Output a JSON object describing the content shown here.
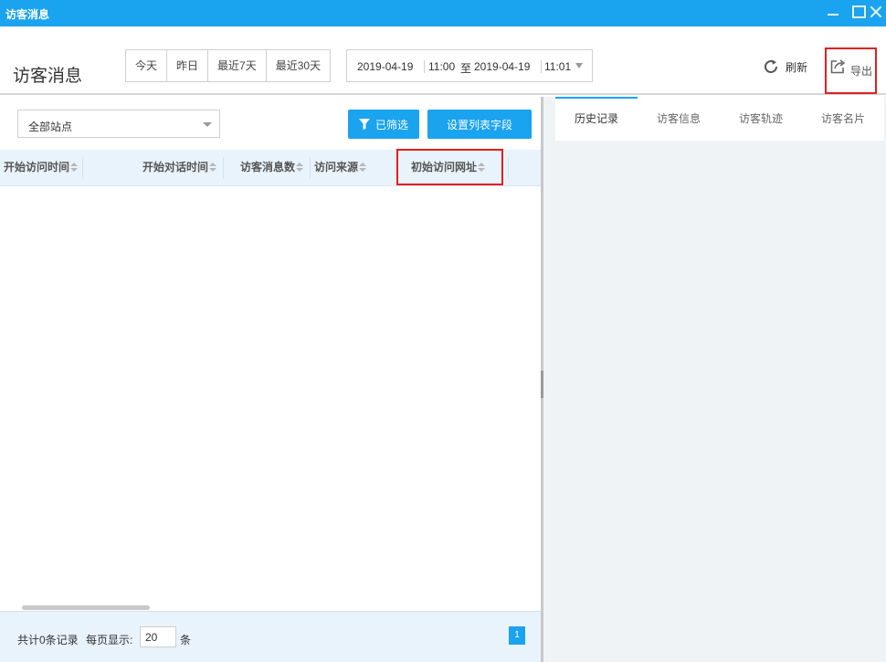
{
  "window": {
    "title": "访客消息"
  },
  "header": {
    "page_title": "访客消息",
    "date_buttons": [
      "今天",
      "昨日",
      "最近7天",
      "最近30天"
    ],
    "range": {
      "start_date": "2019-04-19",
      "start_time": "11:00",
      "to": "至",
      "end_date": "2019-04-19",
      "end_time": "11:01"
    },
    "refresh_label": "刷新",
    "export_label": "导出"
  },
  "toolbar": {
    "site_select_value": "全部站点",
    "filter_label": "已筛选",
    "set_fields_label": "设置列表字段"
  },
  "table": {
    "columns": [
      "开始访问时间",
      "开始对话时间",
      "访客消息数",
      "访问来源",
      "初始访问网址"
    ],
    "rows": []
  },
  "footer": {
    "total_label": "共计0条记录",
    "per_page_label": "每页显示:",
    "page_size": "20",
    "unit": "条",
    "current_page": "1"
  },
  "right_panel": {
    "tabs": [
      "历史记录",
      "访客信息",
      "访客轨迹",
      "访客名片"
    ],
    "active_tab": "历史记录"
  },
  "colors": {
    "accent": "#1aa3ee",
    "highlight": "#e02020",
    "table_header_bg": "#e8f3fb"
  }
}
